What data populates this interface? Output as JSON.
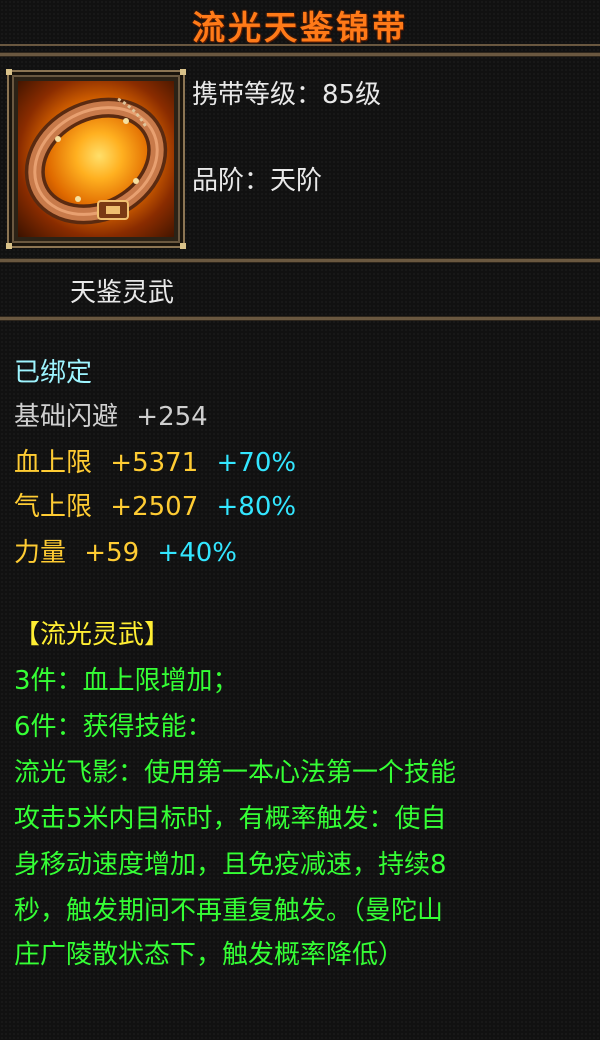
{
  "item": {
    "name": "流光天鉴锦带",
    "carry_level_label": "携带等级：",
    "carry_level_value": "85级",
    "grade_label": "品阶：",
    "grade_value": "天阶",
    "subtitle": "天鉴灵武",
    "icon": "belt-icon"
  },
  "details": {
    "bound": "已绑定",
    "stats": [
      {
        "name": "基础闪避",
        "value": "+254",
        "percent": ""
      },
      {
        "name": "血上限",
        "value": "+5371",
        "percent": "+70%"
      },
      {
        "name": "气上限",
        "value": "+2507",
        "percent": "+80%"
      },
      {
        "name": "力量",
        "value": "+59",
        "percent": "+40%"
      }
    ],
    "set_name": "【流光灵武】",
    "set_lines": [
      "3件：血上限增加；",
      "6件：获得技能：",
      "流光飞影：使用第一本心法第一个技能",
      "攻击5米内目标时，有概率触发：使自",
      "身移动速度增加，且免疫减速，持续8",
      "秒，触发期间不再重复触发。（曼陀山",
      "庄广陵散状态下，触发概率降低）"
    ]
  },
  "colors": {
    "title": "#ff7a18",
    "stat_gold": "#ffcc33",
    "percent_cyan": "#33e6ff",
    "set_green": "#35ff35",
    "set_name_yellow": "#ffee33",
    "frame": "#6a5840"
  }
}
